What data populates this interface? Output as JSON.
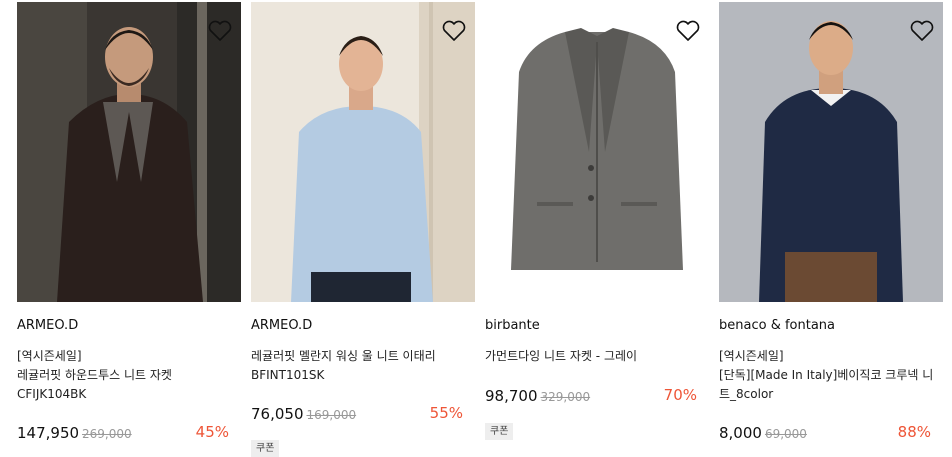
{
  "products": [
    {
      "brand": "ARMEO.D",
      "tag": "[역시즌세일]",
      "name": "레귤러핏 하운드투스 니트 자켓 CFIJK104BK",
      "price": "147,950",
      "original_price": "269,000",
      "discount": "45%",
      "coupon": "",
      "image": "man-in-dark-houndstooth-knit-jacket-with-scarf"
    },
    {
      "brand": "ARMEO.D",
      "tag": "",
      "name": "레귤러핏 멜란지 워싱 울 니트 이태리 BFINT101SK",
      "price": "76,050",
      "original_price": "169,000",
      "discount": "55%",
      "coupon": "쿠폰",
      "image": "man-in-light-blue-wool-sweater"
    },
    {
      "brand": "birbante",
      "tag": "",
      "name": "가먼트다잉 니트 자켓 - 그레이",
      "price": "98,700",
      "original_price": "329,000",
      "discount": "70%",
      "coupon": "쿠폰",
      "image": "grey-knit-jacket-flat"
    },
    {
      "brand": "benaco & fontana",
      "tag": "[역시즌세일]",
      "name": "[단독][Made In Italy]베이직코 크루넥 니트_8color",
      "price": "8,000",
      "original_price": "69,000",
      "discount": "88%",
      "coupon": "",
      "image": "man-in-navy-crewneck-sweater"
    }
  ],
  "colors": {
    "discount": "#ee5537",
    "strikethrough": "#999999",
    "coupon_bg": "#eeeeee"
  },
  "icons": {
    "wishlist": "heart-outline-icon"
  }
}
